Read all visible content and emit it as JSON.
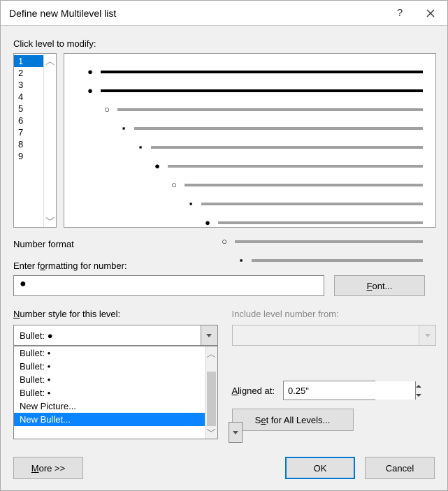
{
  "title": "Define new Multilevel list",
  "help_symbol": "?",
  "labels": {
    "click_level": "Click level to modify:",
    "number_format": "Number format",
    "enter_formatting": "Enter formatting for number:",
    "font_button": "Font...",
    "number_style": "Number style for this level:",
    "include_from": "Include level number from:",
    "bullet_prefix": "B",
    "aligned_at": "Aligned at:",
    "set_all": "Set for All Levels...",
    "more": "More >>",
    "ok": "OK",
    "cancel": "Cancel"
  },
  "levels": [
    "1",
    "2",
    "3",
    "4",
    "5",
    "6",
    "7",
    "8",
    "9"
  ],
  "selected_level_index": 0,
  "preview_marks": [
    "●",
    "●",
    "○",
    "▪",
    "▪",
    "●",
    "○",
    "▪",
    "●",
    "○",
    "▪"
  ],
  "formatting_value": "●",
  "number_style_value": "Bullet:  ●",
  "aligned_at_value": "0.25\"",
  "dropdown_items": [
    "Bullet:   •",
    "Bullet:   •",
    "Bullet:   •",
    "Bullet:   •",
    "New Picture...",
    "New Bullet..."
  ],
  "dropdown_hover_index": 5
}
